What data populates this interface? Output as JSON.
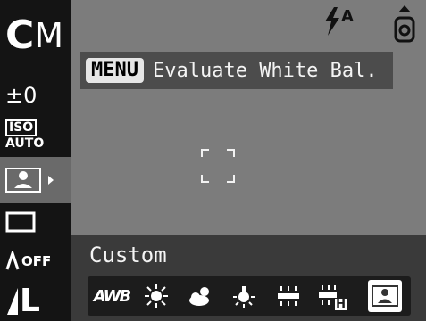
{
  "shooting_mode": {
    "letter": "C",
    "suffix": "M"
  },
  "left_column": {
    "exposure_comp": "±0",
    "iso_top": "ISO",
    "iso_bottom": "AUTO",
    "drive_label": "",
    "flash_output": "OFF",
    "resolution": "L"
  },
  "top_status": {
    "flash_auto": "A",
    "battery_icon": "battery-icon"
  },
  "menu_hint": {
    "key": "MENU",
    "text": "Evaluate White Bal."
  },
  "white_balance": {
    "selected_name": "Custom",
    "options": [
      {
        "id": "awb",
        "label": "AWB",
        "icon": "awb-icon",
        "selected": false
      },
      {
        "id": "daylight",
        "label": "",
        "icon": "sun-icon",
        "selected": false
      },
      {
        "id": "cloudy",
        "label": "",
        "icon": "cloud-icon",
        "selected": false
      },
      {
        "id": "tungsten",
        "label": "",
        "icon": "tungsten-icon",
        "selected": false
      },
      {
        "id": "fluorescent",
        "label": "",
        "icon": "fluorescent-icon",
        "selected": false
      },
      {
        "id": "fluorescent_h",
        "label": "H",
        "icon": "fluorescent-h-icon",
        "selected": false
      },
      {
        "id": "custom",
        "label": "",
        "icon": "custom-wb-icon",
        "selected": true
      }
    ]
  }
}
